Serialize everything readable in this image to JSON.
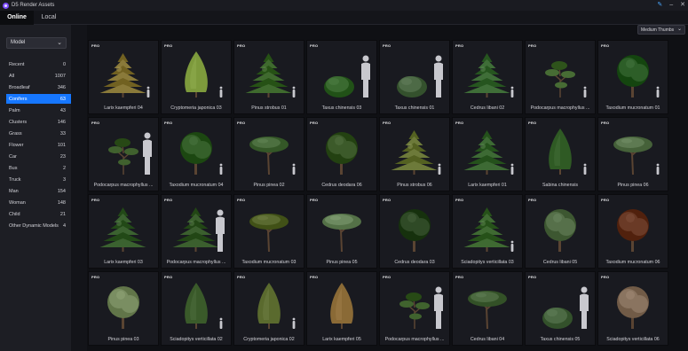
{
  "app": {
    "title": "D5 Render Assets"
  },
  "tabs": {
    "online": "Online",
    "local": "Local"
  },
  "sidebar": {
    "select_label": "Model",
    "categories": [
      {
        "label": "Recent",
        "count": "0"
      },
      {
        "label": "All",
        "count": "1007"
      },
      {
        "label": "Broadleaf",
        "count": "346"
      },
      {
        "label": "Conifers",
        "count": "63",
        "active": true
      },
      {
        "label": "Palm",
        "count": "43"
      },
      {
        "label": "Clusters",
        "count": "146"
      },
      {
        "label": "Grass",
        "count": "33"
      },
      {
        "label": "Flower",
        "count": "101"
      },
      {
        "label": "Car",
        "count": "23"
      },
      {
        "label": "Bus",
        "count": "2"
      },
      {
        "label": "Truck",
        "count": "3"
      },
      {
        "label": "Man",
        "count": "154"
      },
      {
        "label": "Woman",
        "count": "148"
      },
      {
        "label": "Child",
        "count": "21"
      },
      {
        "label": "Other Dynamic Models",
        "count": "4"
      }
    ]
  },
  "main": {
    "thumb_size_label": "Medium Thumbs",
    "badge": "PRO",
    "assets": [
      {
        "name": "Larix kaempferi 04",
        "shape": "conifer",
        "color": "#8a7a3a",
        "person": "small"
      },
      {
        "name": "Cryptomeria japonica 03",
        "shape": "cone",
        "color": "#7d9a3c",
        "person": "small"
      },
      {
        "name": "Pinus strobus 01",
        "shape": "conifer",
        "color": "#3f6a2e",
        "person": "small"
      },
      {
        "name": "Taxus chinensis 03",
        "shape": "bush",
        "color": "#3a6a30",
        "person": "large"
      },
      {
        "name": "Taxus chinensis 01",
        "shape": "bush",
        "color": "#4d6a46",
        "person": "large"
      },
      {
        "name": "Cedrus libani 02",
        "shape": "conifer",
        "color": "#3f6e38",
        "person": "small"
      },
      {
        "name": "Podocarpus macrophyllus ...",
        "shape": "pad",
        "color": "#476c34",
        "person": "small"
      },
      {
        "name": "Taxodium mucronatum 01",
        "shape": "round",
        "color": "#2d5e28",
        "person": "small"
      },
      {
        "name": "Podocarpus macrophyllus ...",
        "shape": "pad",
        "color": "#40612e",
        "person": "large"
      },
      {
        "name": "Taxodium mucronatum 04",
        "shape": "round",
        "color": "#35602a",
        "person": "small"
      },
      {
        "name": "Pinus pinea 02",
        "shape": "umbrella",
        "color": "#4d7040",
        "person": "small"
      },
      {
        "name": "Cedrus deodara 06",
        "shape": "round",
        "color": "#3c5a2a",
        "person": "none"
      },
      {
        "name": "Pinus strobus 06",
        "shape": "conifer",
        "color": "#6d7a3a",
        "person": "small"
      },
      {
        "name": "Larix kaempferi 01",
        "shape": "conifer",
        "color": "#3d6a34",
        "person": "small"
      },
      {
        "name": "Sabina chinensis",
        "shape": "cone",
        "color": "#2f5a24",
        "person": "small"
      },
      {
        "name": "Pinus pinea 06",
        "shape": "umbrella",
        "color": "#5e7a52",
        "person": "small"
      },
      {
        "name": "Larix kaempferi 03",
        "shape": "conifer",
        "color": "#3b6230",
        "person": "none"
      },
      {
        "name": "Podocarpus macrophyllus ...",
        "shape": "conifer",
        "color": "#3b5f2e",
        "person": "large"
      },
      {
        "name": "Taxodium mucronatum 03",
        "shape": "umbrella",
        "color": "#5a6a30",
        "person": "none"
      },
      {
        "name": "Pinus pinea 05",
        "shape": "umbrella",
        "color": "#6d8a60",
        "person": "none"
      },
      {
        "name": "Cedrus deodara 03",
        "shape": "round",
        "color": "#2f4a26",
        "person": "none"
      },
      {
        "name": "Sciadopitys verticillata 03",
        "shape": "conifer",
        "color": "#3f6a32",
        "person": "small"
      },
      {
        "name": "Cedrus libani 05",
        "shape": "round",
        "color": "#56704a",
        "person": "none"
      },
      {
        "name": "Taxodium mucronatum 06",
        "shape": "round",
        "color": "#6a3a26",
        "person": "none"
      },
      {
        "name": "Pinus pinea 03",
        "shape": "round",
        "color": "#7a8e62",
        "person": "none"
      },
      {
        "name": "Sciadopitys verticillata 02",
        "shape": "cone",
        "color": "#3a5a2a",
        "person": "small"
      },
      {
        "name": "Cryptomeria japonica 02",
        "shape": "cone",
        "color": "#5a6a2e",
        "person": "small"
      },
      {
        "name": "Larix kaempferi 05",
        "shape": "cone",
        "color": "#8a6a36",
        "person": "none"
      },
      {
        "name": "Podocarpus macrophyllus ...",
        "shape": "pad",
        "color": "#40632e",
        "person": "large"
      },
      {
        "name": "Cedrus libani 04",
        "shape": "umbrella",
        "color": "#4c6a40",
        "person": "none"
      },
      {
        "name": "Taxus chinensis 05",
        "shape": "bush",
        "color": "#4c6a44",
        "person": "large"
      },
      {
        "name": "Sciadopitys verticillata 06",
        "shape": "round",
        "color": "#8a7460",
        "person": "none"
      }
    ]
  }
}
